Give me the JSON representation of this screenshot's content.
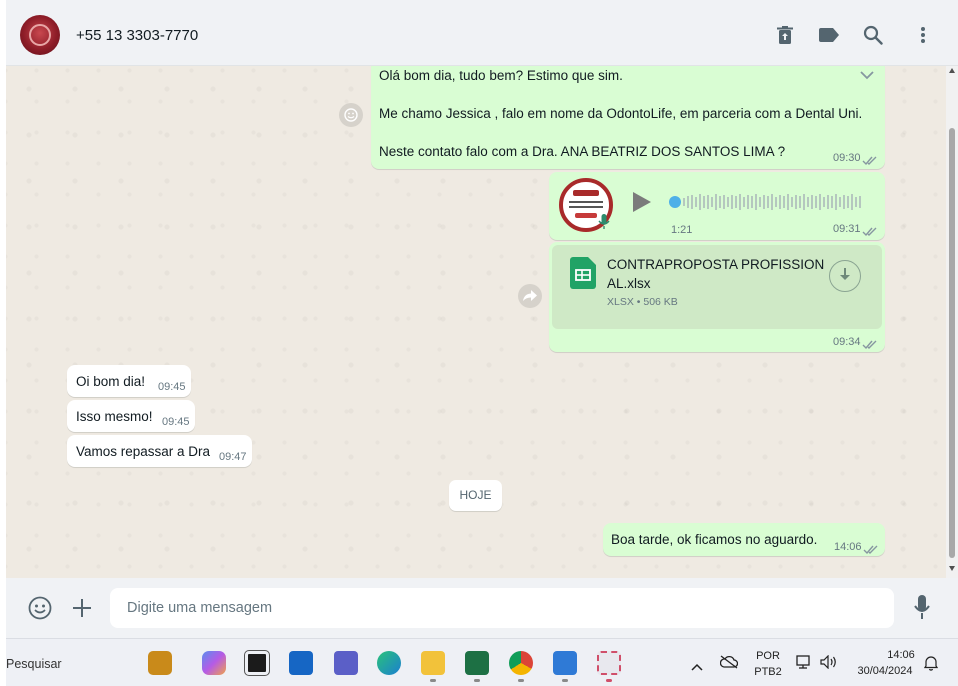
{
  "header": {
    "contact_name": "+55 13 3303-7770",
    "icons": [
      "delete-icon",
      "label-icon",
      "search-icon",
      "menu-icon"
    ]
  },
  "messages": {
    "first": {
      "line1": "Olá bom dia, tudo bem? Estimo que sim.",
      "line2": "Me chamo Jessica , falo em nome da OdontoLife, em parceria com a Dental Uni.",
      "line3": "Neste contato falo com a Dra. ANA BEATRIZ DOS SANTOS LIMA ?",
      "time": "09:30"
    },
    "audio": {
      "duration": "1:21",
      "time": "09:31",
      "progress": 0
    },
    "file": {
      "name_line1": "CONTRAPROPOSTA PROFISSION",
      "name_line2": "AL.xlsx",
      "meta": "XLSX • 506 KB",
      "time": "09:34"
    },
    "in1": {
      "text": "Oi bom dia!",
      "time": "09:45"
    },
    "in2": {
      "text": "Isso mesmo!",
      "time": "09:45"
    },
    "in3": {
      "text": "Vamos repassar a Dra",
      "time": "09:47"
    },
    "date_divider": "HOJE",
    "out_last": {
      "text": "Boa tarde, ok ficamos no aguardo.",
      "time": "14:06"
    }
  },
  "composer": {
    "placeholder": "Digite uma mensagem"
  },
  "taskbar": {
    "search_label": "Pesquisar",
    "lang_top": "POR",
    "lang_bottom": "PTB2",
    "clock_time": "14:06",
    "clock_date": "30/04/2024"
  },
  "colors": {
    "outgoing_bubble": "#d9fdd3",
    "incoming_bubble": "#ffffff",
    "chat_bg": "#efeae2",
    "header_bg": "#f0f2f5",
    "read_ticks": "#8696a0"
  }
}
